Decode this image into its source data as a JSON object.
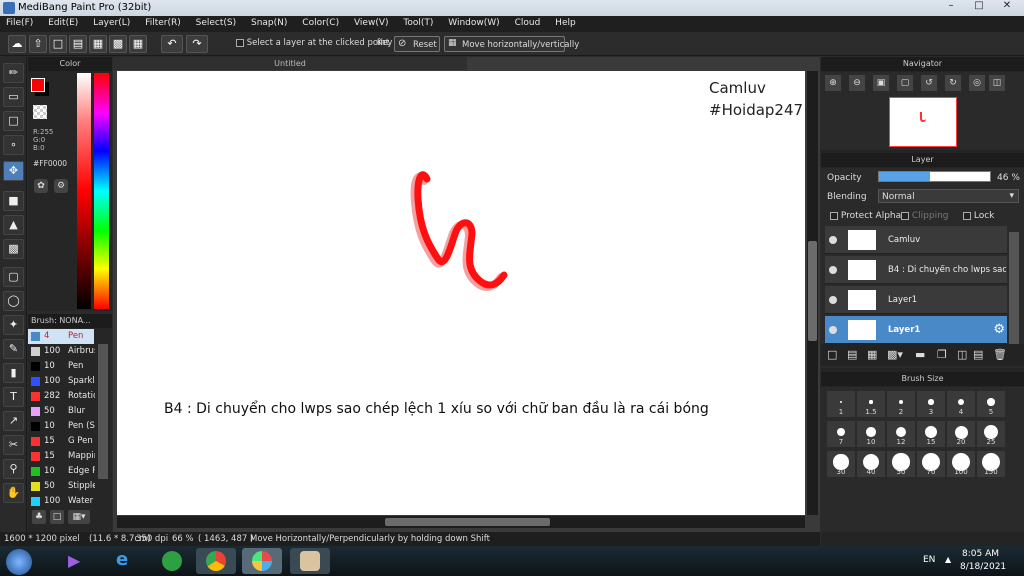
{
  "app": {
    "title": "MediBang Paint Pro (32bit)"
  },
  "menu": [
    "File(F)",
    "Edit(E)",
    "Layer(L)",
    "Filter(R)",
    "Select(S)",
    "Snap(N)",
    "Color(C)",
    "View(V)",
    "Tool(T)",
    "Window(W)",
    "Cloud",
    "Help"
  ],
  "toolbar": {
    "select_layer_label": "Select a layer at the clicked point",
    "key_label": "Key",
    "reset_label": "Reset",
    "move_label": "Move horizontally/vertically"
  },
  "color_panel": {
    "title": "Color",
    "r": "R:255",
    "g": "G:0",
    "b": "B:0",
    "hex": "#FF0000",
    "primary_color": "#ff0000",
    "secondary_color": "#000000"
  },
  "brush_panel": {
    "title": "Brush: NONA...",
    "items": [
      {
        "size": "4",
        "name": "Pen",
        "color": "#4a89c8"
      },
      {
        "size": "100",
        "name": "Airbrush",
        "color": "#cfcfcf"
      },
      {
        "size": "10",
        "name": "Pen",
        "color": "#000000"
      },
      {
        "size": "100",
        "name": "Sparkle",
        "color": "#3050ff"
      },
      {
        "size": "282",
        "name": "Rotation",
        "color": "#ff3030"
      },
      {
        "size": "50",
        "name": "Blur",
        "color": "#e8a0ff"
      },
      {
        "size": "10",
        "name": "Pen (S",
        "color": "#000000"
      },
      {
        "size": "15",
        "name": "G Pen",
        "color": "#ff3030"
      },
      {
        "size": "15",
        "name": "Mapping",
        "color": "#ff3030"
      },
      {
        "size": "10",
        "name": "Edge P",
        "color": "#20c020"
      },
      {
        "size": "50",
        "name": "Stipple",
        "color": "#e0e020"
      },
      {
        "size": "100",
        "name": "Water",
        "color": "#20d0ff"
      }
    ]
  },
  "document": {
    "tab": "Untitled",
    "watermark_line1": "Camluv",
    "watermark_line2": "#Hoidap247",
    "caption": "B4 : Di chuyển cho lwps sao chép lệch 1 xíu so với chữ ban đầu là ra cái bóng"
  },
  "status": {
    "size": "1600 * 1200 pixel",
    "cm": "(11.6 * 8.7cm)",
    "dpi": "350 dpi",
    "zoom": "66 %",
    "coords": "( 1463, 487 )",
    "hint": "Move Horizontally/Perpendicularly by holding down Shift"
  },
  "navigator": {
    "title": "Navigator"
  },
  "layer_panel": {
    "title": "Layer",
    "opacity_label": "Opacity",
    "opacity_value": "46 %",
    "opacity_fraction": 0.46,
    "blending_label": "Blending",
    "blending_value": "Normal",
    "protect_alpha": "Protect Alpha",
    "clipping": "Clipping",
    "lock": "Lock",
    "layers": [
      {
        "name": "Camluv",
        "selected": false
      },
      {
        "name": "B4 : Di chuyển cho lwps sao chép",
        "selected": false
      },
      {
        "name": "Layer1",
        "selected": false
      },
      {
        "name": "Layer1",
        "selected": true
      }
    ]
  },
  "brush_size": {
    "title": "Brush Size",
    "sizes": [
      "1",
      "1.5",
      "2",
      "3",
      "4",
      "5",
      "7",
      "10",
      "12",
      "15",
      "20",
      "25",
      "30",
      "40",
      "50",
      "70",
      "100",
      "150"
    ]
  },
  "taskbar": {
    "lang": "EN",
    "time": "8:05 AM",
    "date": "8/18/2021"
  }
}
